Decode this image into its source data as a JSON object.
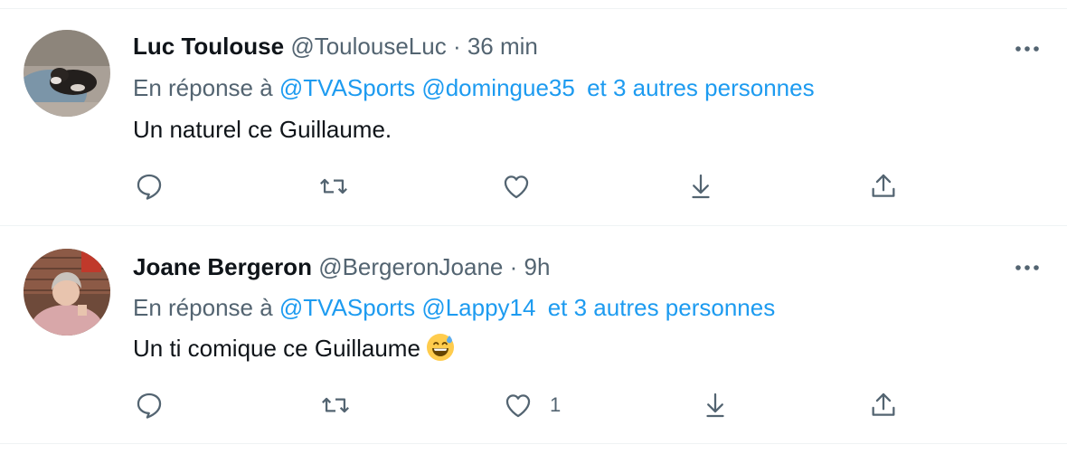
{
  "colors": {
    "text_primary": "#0f1419",
    "text_secondary": "#536471",
    "link": "#1d9bf0",
    "divider": "#eff3f4"
  },
  "tweets": [
    {
      "display_name": "Luc Toulouse",
      "handle": "@ToulouseLuc",
      "separator": "·",
      "time": "36 min",
      "reply_prefix": "En réponse à",
      "mentions": [
        "@TVASports",
        "@domingue35"
      ],
      "others": "et 3 autres personnes",
      "text": "Un naturel ce Guillaume.",
      "has_emoji": false,
      "like_count": "",
      "icons": [
        "reply-icon",
        "retweet-icon",
        "like-icon",
        "download-icon",
        "share-icon",
        "more-icon"
      ]
    },
    {
      "display_name": "Joane Bergeron",
      "handle": "@BergeronJoane",
      "separator": "·",
      "time": "9h",
      "reply_prefix": "En réponse à",
      "mentions": [
        "@TVASports",
        "@Lappy14"
      ],
      "others": "et 3 autres personnes",
      "text": "Un ti comique ce Guillaume",
      "has_emoji": true,
      "emoji": "grinning-face-with-sweat",
      "like_count": "1",
      "icons": [
        "reply-icon",
        "retweet-icon",
        "like-icon",
        "download-icon",
        "share-icon",
        "more-icon"
      ]
    }
  ]
}
